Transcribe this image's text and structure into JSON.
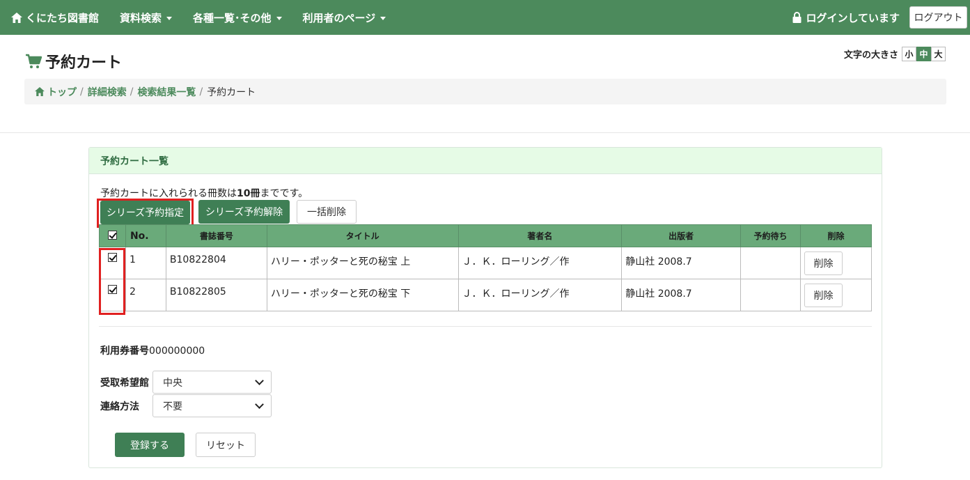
{
  "nav": {
    "brand": "くにたち図書館",
    "items": [
      {
        "label": "資料検索"
      },
      {
        "label": "各種一覧･その他"
      },
      {
        "label": "利用者のページ"
      }
    ],
    "login_status": "ログインしています",
    "logout": "ログアウト"
  },
  "page": {
    "title": "予約カート",
    "font_size_label": "文字の大きさ",
    "font_sizes": [
      "小",
      "中",
      "大"
    ],
    "font_size_selected": "中"
  },
  "breadcrumb": {
    "items": [
      "トップ",
      "詳細検索",
      "検索結果一覧"
    ],
    "separator": "/",
    "current": "予約カート"
  },
  "panel": {
    "title": "予約カート一覧",
    "notice_pre": "予約カートに入れられる冊数は",
    "notice_bold": "10冊",
    "notice_post": "までです。",
    "buttons": {
      "series_set": "シリーズ予約指定",
      "series_unset": "シリーズ予約解除",
      "bulk_delete": "一括削除"
    },
    "table": {
      "headers": [
        "No.",
        "書誌番号",
        "タイトル",
        "著者名",
        "出版者",
        "予約待ち",
        "削除"
      ],
      "rows": [
        {
          "checked": true,
          "no": "1",
          "id": "B10822804",
          "title": "ハリー・ポッターと死の秘宝 上",
          "author": "Ｊ．Ｋ．ローリング／作",
          "publisher": "静山社 2008.7",
          "waiting": "",
          "delete": "削除"
        },
        {
          "checked": true,
          "no": "2",
          "id": "B10822805",
          "title": "ハリー・ポッターと死の秘宝 下",
          "author": "Ｊ．Ｋ．ローリング／作",
          "publisher": "静山社 2008.7",
          "waiting": "",
          "delete": "削除"
        }
      ]
    },
    "card_label": "利用券番号",
    "card_value": "000000000",
    "pickup_label": "受取希望館",
    "pickup_value": "中央",
    "contact_label": "連絡方法",
    "contact_value": "不要",
    "register": "登録する",
    "reset": "リセット"
  },
  "colors": {
    "brand_green": "#4c8a5c",
    "button_green": "#3f7f55",
    "table_header": "#6aaa7a",
    "highlight_red": "#e02020"
  }
}
